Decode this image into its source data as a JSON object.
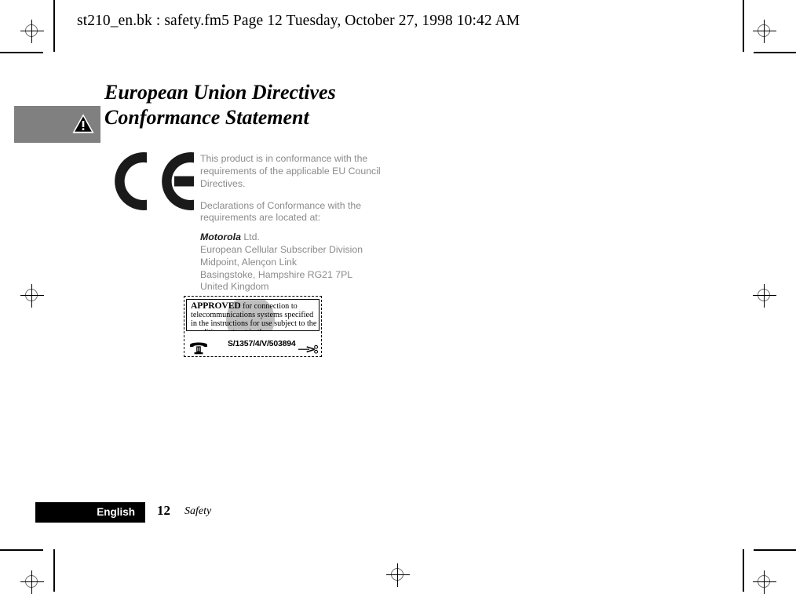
{
  "header": {
    "running_head": "st210_en.bk : safety.fm5  Page 12  Tuesday, October 27, 1998  10:42 AM"
  },
  "title": {
    "line1": "European Union Directives",
    "line2": "Conformance Statement"
  },
  "warning": {
    "icon": "warning-triangle-icon",
    "box_color": "#808080"
  },
  "ce_mark": {
    "label": "CE"
  },
  "body": {
    "paragraph1": "This product is in conformance with the requirements of the applicable EU Council Directives.",
    "paragraph2": "Declarations of Conformance with the requirements are located at:",
    "address": {
      "brand": "Motorola",
      "brand_suffix": " Ltd.",
      "line2": "European Cellular Subscriber Division",
      "line3": "Midpoint, Alençon Link",
      "line4": "Basingstoke, Hampshire RG21 7PL",
      "line5": "United Kingdom"
    }
  },
  "approval_label": {
    "statement_bold": "APPROVED",
    "statement_rest": " for connection to telecommunications systems specified in the instructions for use subject to the conditions set out in them.",
    "approval_number": "S/1357/4/V/503894",
    "phone_icon": "telephone-icon",
    "scissors_icon": "scissors-icon"
  },
  "footer": {
    "language": "English",
    "page_number": "12",
    "section": "Safety"
  }
}
